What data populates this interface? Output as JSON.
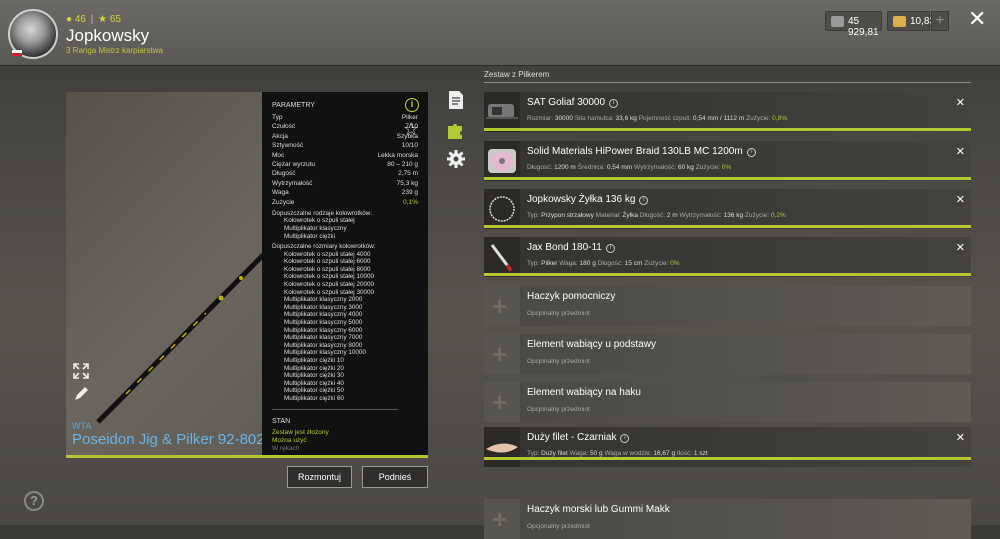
{
  "header": {
    "level": "46",
    "stars": "65",
    "username": "Jopkowsky",
    "rank": "3 Ranga Mistrz karpiarstwa",
    "money": "45 929,81",
    "gold": "10,83",
    "plus": "+",
    "close": "✕"
  },
  "rod": {
    "brand": "WTA",
    "name": "Poseidon Jig & Pilker 92-802",
    "params_title": "PARAMETRY",
    "params": [
      {
        "k": "Typ",
        "v": "Pilker"
      },
      {
        "k": "Czułość",
        "v": "7/10"
      },
      {
        "k": "Akcja",
        "v": "Szybka"
      },
      {
        "k": "Sztywność",
        "v": "10/10"
      },
      {
        "k": "Moc",
        "v": "Lekka morska"
      },
      {
        "k": "Ciężar wyrzutu",
        "v": "80 – 210 g"
      },
      {
        "k": "Długość",
        "v": "2,75 m"
      },
      {
        "k": "Wytrzymałość",
        "v": "75,3 kg"
      },
      {
        "k": "Waga",
        "v": "239 g"
      },
      {
        "k": "Zużycie",
        "v": "0,1%"
      }
    ],
    "reel_types_title": "Dopuszczalne rodzaje kołowrotków:",
    "reel_types": [
      "Kołowrotek o szpuli stałej",
      "Multiplikator klasyczny",
      "Multiplikator ciężki"
    ],
    "reel_sizes_title": "Dopuszczalne rozmiary kołowrotków:",
    "reel_sizes": [
      "Kołowrotek o szpuli stałej 4000",
      "Kołowrotek o szpuli stałej 6000",
      "Kołowrotek o szpuli stałej 8000",
      "Kołowrotek o szpuli stałej 10000",
      "Kołowrotek o szpuli stałej 20000",
      "Kołowrotek o szpuli stałej 30000",
      "Multiplikator klasyczny 2000",
      "Multiplikator klasyczny 3000",
      "Multiplikator klasyczny 4000",
      "Multiplikator klasyczny 5000",
      "Multiplikator klasyczny 6000",
      "Multiplikator klasyczny 7000",
      "Multiplikator klasyczny 8000",
      "Multiplikator klasyczny 10000",
      "Multiplikator ciężki 10",
      "Multiplikator ciężki 20",
      "Multiplikator ciężki 30",
      "Multiplikator ciężki 40",
      "Multiplikator ciężki 50",
      "Multiplikator ciężki 60"
    ],
    "stan_title": "STAN",
    "stan_lines": [
      "Zestaw jest złożony",
      "Można użyć"
    ],
    "stan_dim": "W rękach"
  },
  "buttons": {
    "dismantle": "Rozmontuj",
    "pickup": "Podnieś"
  },
  "list": {
    "title": "Zestaw z Pilkerem",
    "slots": [
      {
        "name": "SAT Goliaf 30000",
        "details": [
          [
            "Rozmiar:",
            "30000"
          ],
          [
            "Siła hamulca:",
            "33,6 kg"
          ],
          [
            "Pojemność szpuli:",
            "0,54 mm / 1112 m"
          ],
          [
            "Zużycie:",
            "0,8%"
          ]
        ]
      },
      {
        "name": "Solid Materials HiPower Braid 130LB MC 1200m",
        "details": [
          [
            "Długość:",
            "1200 m"
          ],
          [
            "Średnica:",
            "0,54 mm"
          ],
          [
            "Wytrzymałość:",
            "60 kg"
          ],
          [
            "Zużycie:",
            "0%"
          ]
        ]
      },
      {
        "name": "Jopkowsky Żyłka 136 kg",
        "details": [
          [
            "Typ:",
            "Przypon strzałowy"
          ],
          [
            "Materiał:",
            "Żyłka"
          ],
          [
            "Długość:",
            "2 m"
          ],
          [
            "Wytrzymałość:",
            "136 kg"
          ],
          [
            "Zużycie:",
            "0,2%"
          ]
        ]
      },
      {
        "name": "Jax Bond 180-11",
        "details": [
          [
            "Typ:",
            "Pilker"
          ],
          [
            "Waga:",
            "180 g"
          ],
          [
            "Długość:",
            "15 cm"
          ],
          [
            "Zużycie:",
            "0%"
          ]
        ]
      },
      {
        "name": "Haczyk pomocniczy",
        "optional": "Opcjonalny przedmiot"
      },
      {
        "name": "Element wabiący u podstawy",
        "optional": "Opcjonalny przedmiot"
      },
      {
        "name": "Element wabiący na haku",
        "optional": "Opcjonalny przedmiot"
      },
      {
        "name": "Duży filet - Czarniak",
        "details": [
          [
            "Typ:",
            "Duży filet"
          ],
          [
            "Waga:",
            "50 g"
          ],
          [
            "Waga w wodzie:",
            "16,67 g"
          ],
          [
            "Ilość:",
            "1 szt"
          ]
        ]
      },
      {
        "name": "Haczyk morski lub Gummi Makk",
        "optional": "Opcjonalny przedmiot"
      }
    ]
  },
  "colors": {
    "accent": "#b3c934",
    "rod_name": "#6ab4e6"
  }
}
